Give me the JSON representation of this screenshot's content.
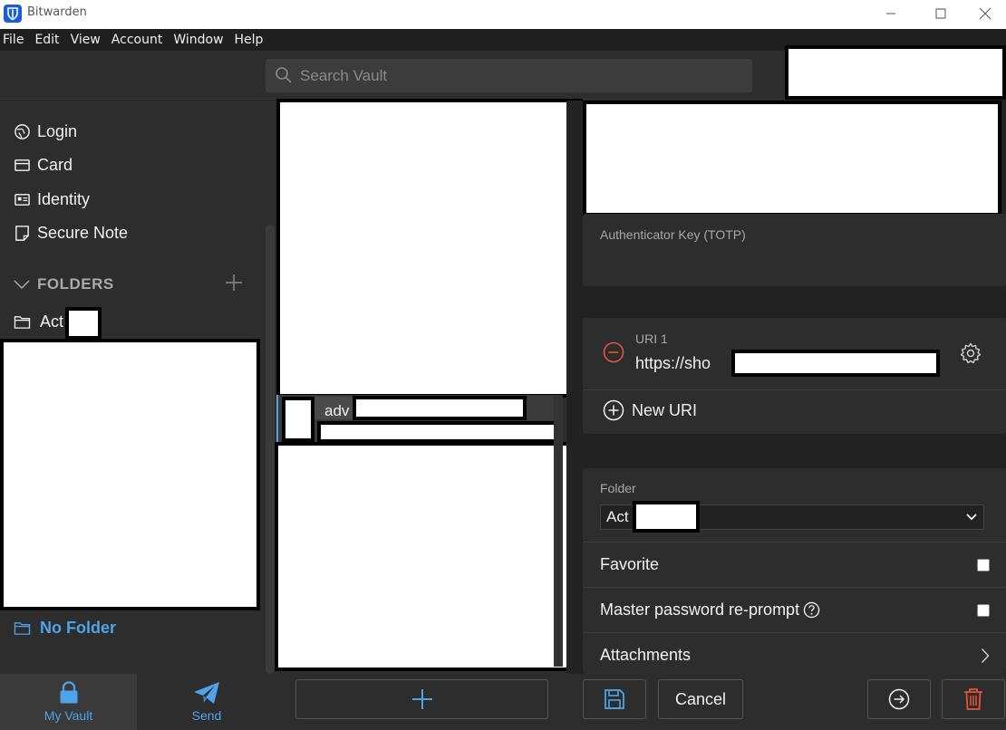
{
  "window": {
    "title": "Bitwarden"
  },
  "menu": {
    "items": [
      "File",
      "Edit",
      "View",
      "Account",
      "Window",
      "Help"
    ]
  },
  "search": {
    "placeholder": "Search Vault"
  },
  "sidebar": {
    "types": [
      {
        "label": "Login",
        "icon": "globe-icon"
      },
      {
        "label": "Card",
        "icon": "credit-card-icon"
      },
      {
        "label": "Identity",
        "icon": "id-card-icon"
      },
      {
        "label": "Secure Note",
        "icon": "sticky-note-icon"
      }
    ],
    "folders_heading": "FOLDERS",
    "folders": [
      {
        "label": "Act"
      }
    ],
    "no_folder_label": "No Folder"
  },
  "bottom_nav": {
    "vault_label": "My Vault",
    "send_label": "Send"
  },
  "list": {
    "selected_item_title": "adv"
  },
  "detail": {
    "totp_label": "Authenticator Key (TOTP)",
    "uri_label": "URI 1",
    "uri_value": "https://sho",
    "new_uri_label": "New URI",
    "folder_label": "Folder",
    "folder_value": "Act",
    "favorite_label": "Favorite",
    "reprompt_label": "Master password re-prompt",
    "attachments_label": "Attachments",
    "cancel_label": "Cancel"
  },
  "colors": {
    "accent": "#4fa3e8",
    "danger": "#e5533d",
    "background": "#222222",
    "panel": "#2d2d2d"
  }
}
